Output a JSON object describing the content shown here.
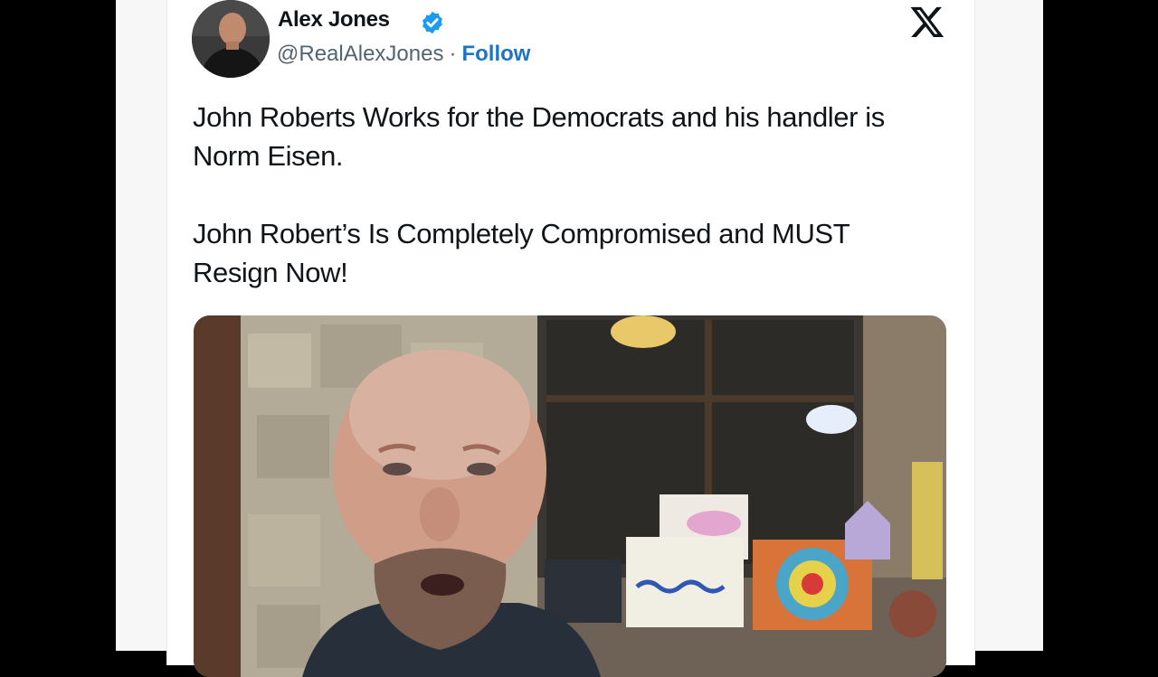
{
  "tweet": {
    "display_name": "Alex Jones",
    "handle": "@RealAlexJones",
    "separator": "·",
    "follow_label": "Follow",
    "paragraphs": [
      "John Roberts Works for the Democrats and his handler is Norm Eisen.",
      "John Robert’s Is Completely Compromised and MUST Resign Now!"
    ]
  },
  "icons": {
    "verified": "verified-badge-icon",
    "platform_logo": "x-logo-icon"
  },
  "colors": {
    "verified_blue": "#1d9bf0",
    "follow_blue": "#1d74c6",
    "text_primary": "#0f1419",
    "text_secondary": "#536471"
  }
}
